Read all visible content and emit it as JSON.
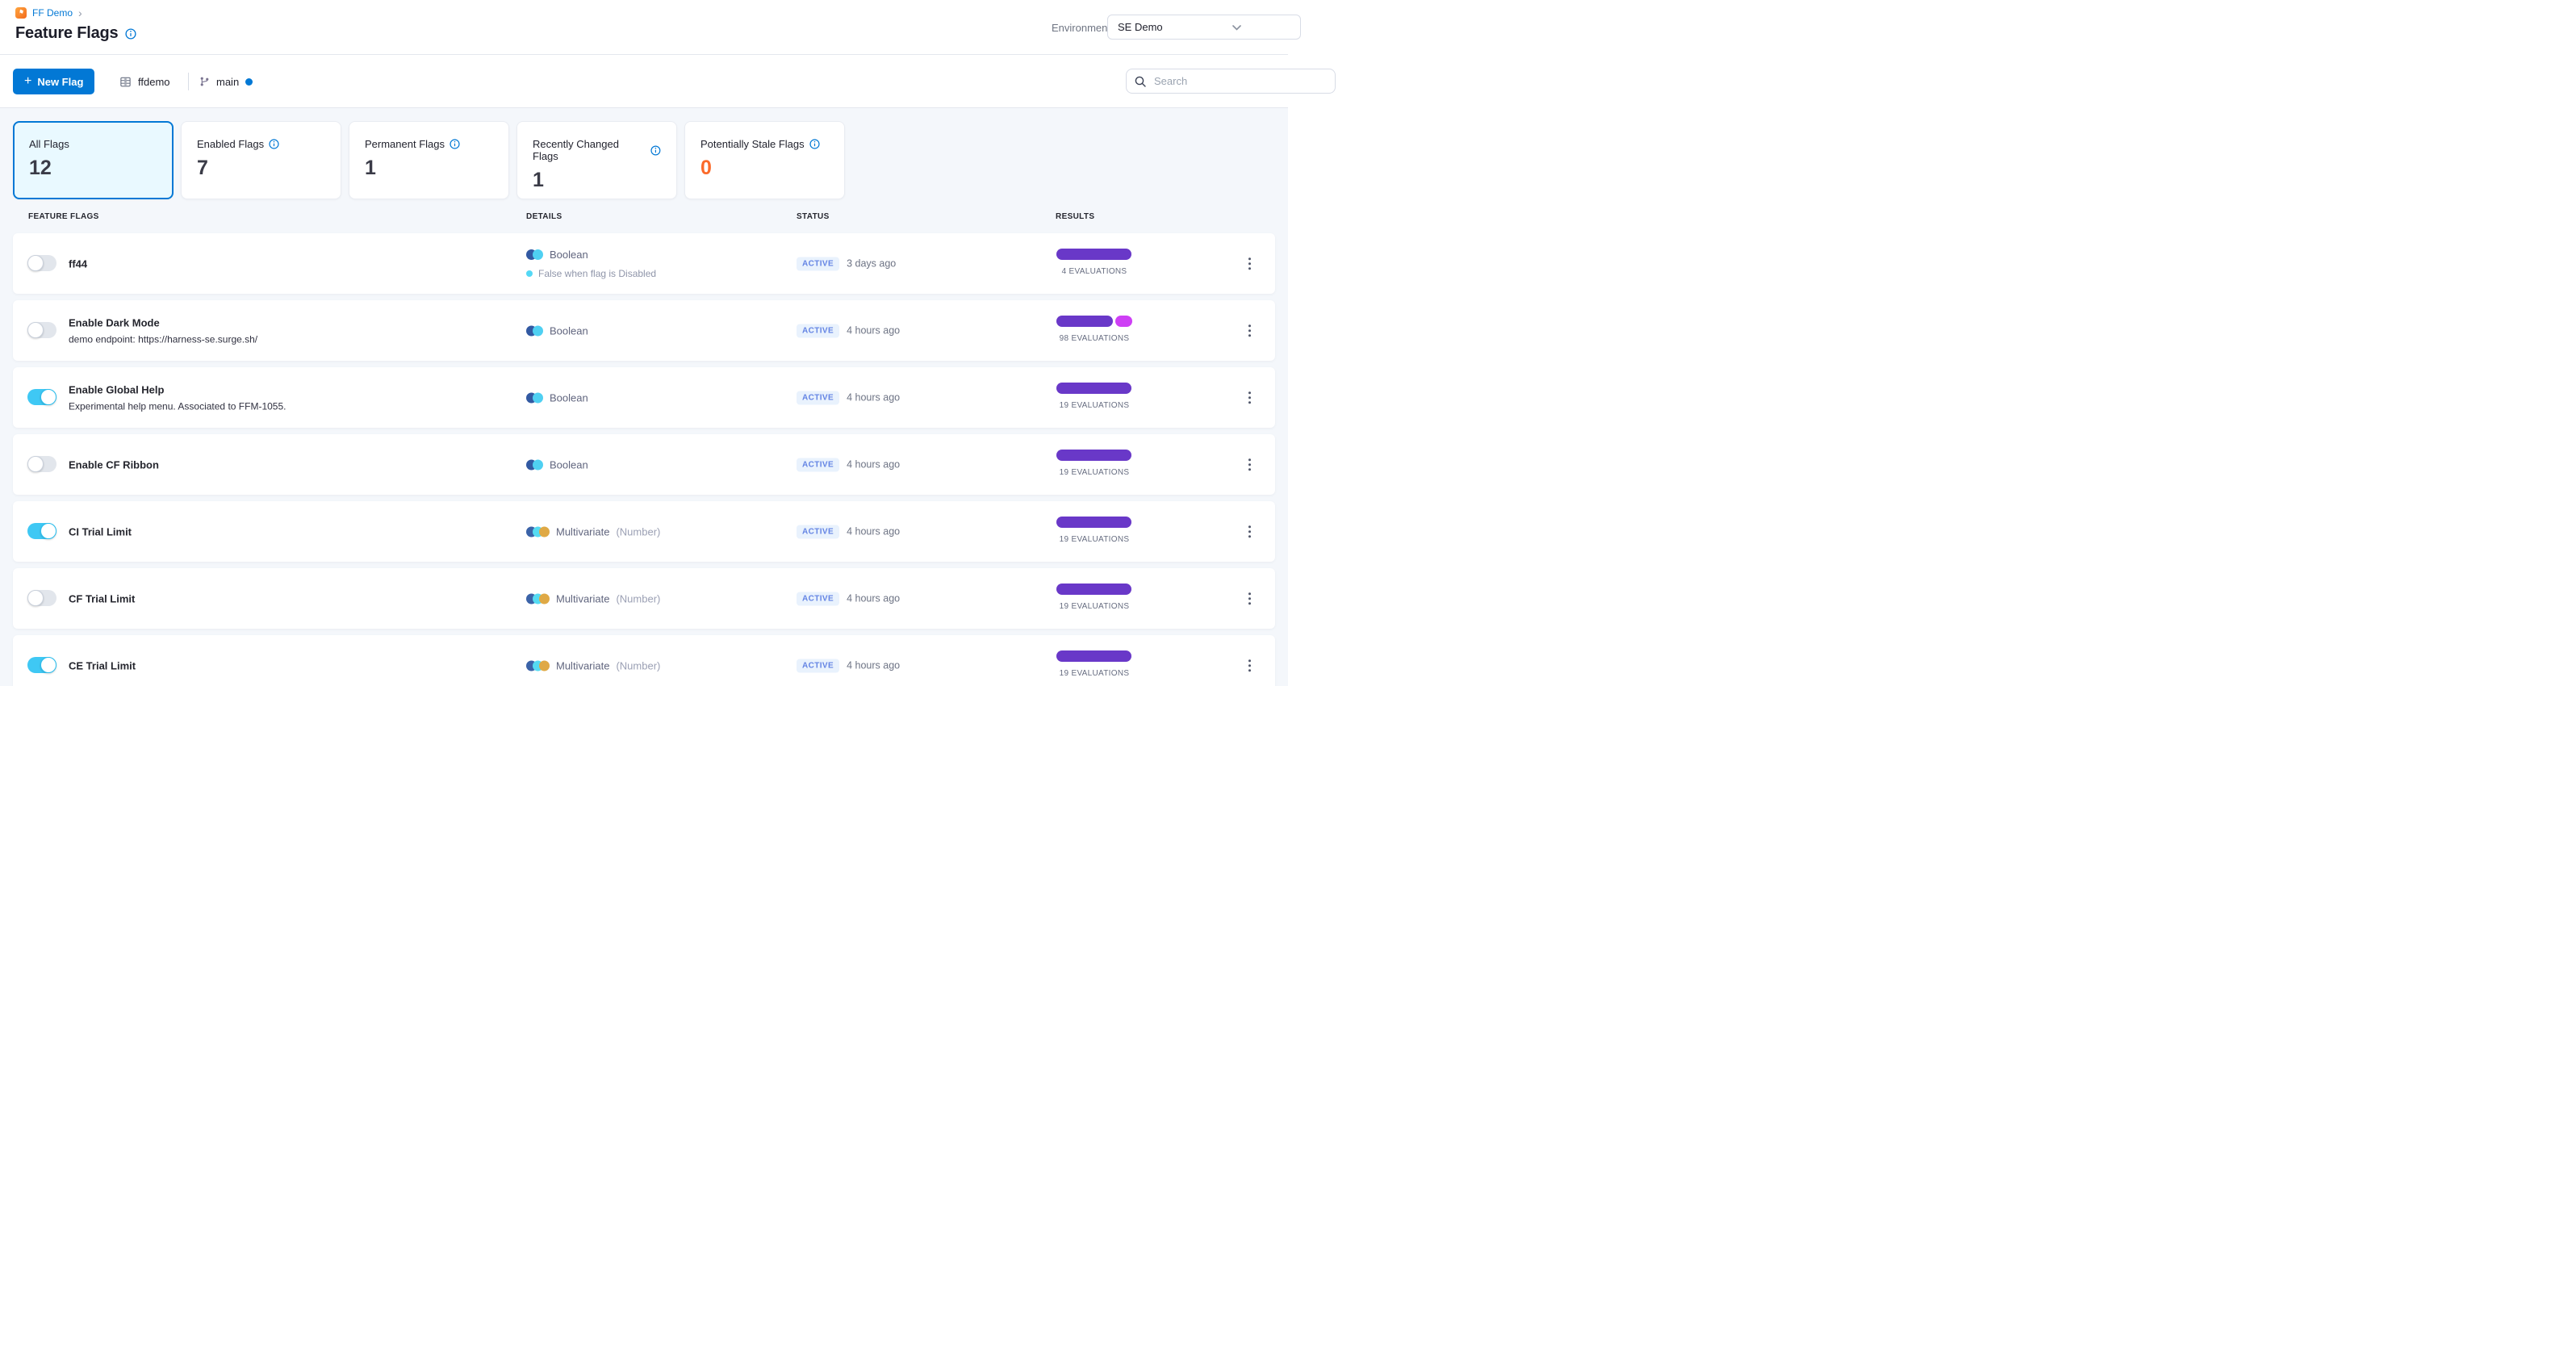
{
  "breadcrumb": {
    "project": "FF Demo",
    "chevron": "›"
  },
  "header": {
    "title": "Feature Flags",
    "environment_label": "Environment",
    "environment_value": "SE Demo"
  },
  "toolbar": {
    "plus": "+",
    "new_flag_label": "New Flag",
    "repo": "ffdemo",
    "branch": "main",
    "search_placeholder": "Search"
  },
  "stats": {
    "cards": [
      {
        "label": "All Flags",
        "value": "12",
        "selected": true,
        "info": false
      },
      {
        "label": "Enabled Flags",
        "value": "7",
        "selected": false,
        "info": true
      },
      {
        "label": "Permanent Flags",
        "value": "1",
        "selected": false,
        "info": true
      },
      {
        "label": "Recently Changed Flags",
        "value": "1",
        "selected": false,
        "info": true
      },
      {
        "label": "Potentially Stale Flags",
        "value": "0",
        "selected": false,
        "info": true,
        "value_color": "#fb6a2a"
      }
    ]
  },
  "colors": {
    "accent_blue": "#0278d5",
    "toggle_on": "#3fc8f4",
    "stale_orange": "#fb6a2a",
    "note_dot": "#54d8f5",
    "type_icons": {
      "Boolean": [
        "#3259a2",
        "#4fd0f2"
      ],
      "Multivariate": [
        "#3b63a8",
        "#55dbf2",
        "#dfa945"
      ]
    }
  },
  "table": {
    "headers": [
      "FEATURE FLAGS",
      "DETAILS",
      "STATUS",
      "RESULTS"
    ],
    "rows": [
      {
        "name": "ff44",
        "description": "",
        "enabled": false,
        "type": "Boolean",
        "type_suffix": "",
        "note": "False when flag is Disabled",
        "status": "ACTIVE",
        "updated": "3 days ago",
        "evaluations": "4 EVALUATIONS",
        "bars": [
          {
            "color": "#6938c8",
            "width": 93
          }
        ]
      },
      {
        "name": "Enable Dark Mode",
        "description": "demo endpoint: https://harness-se.surge.sh/",
        "enabled": false,
        "type": "Boolean",
        "type_suffix": "",
        "note": "",
        "status": "ACTIVE",
        "updated": "4 hours ago",
        "evaluations": "98 EVALUATIONS",
        "bars": [
          {
            "color": "#6938c8",
            "width": 70
          },
          {
            "color": "#ce3ff5",
            "width": 21
          }
        ]
      },
      {
        "name": "Enable Global Help",
        "description": "Experimental help menu. Associated to FFM-1055.",
        "enabled": true,
        "type": "Boolean",
        "type_suffix": "",
        "note": "",
        "status": "ACTIVE",
        "updated": "4 hours ago",
        "evaluations": "19 EVALUATIONS",
        "bars": [
          {
            "color": "#6938c8",
            "width": 93
          }
        ]
      },
      {
        "name": "Enable CF Ribbon",
        "description": "",
        "enabled": false,
        "type": "Boolean",
        "type_suffix": "",
        "note": "",
        "status": "ACTIVE",
        "updated": "4 hours ago",
        "evaluations": "19 EVALUATIONS",
        "bars": [
          {
            "color": "#6938c8",
            "width": 93
          }
        ]
      },
      {
        "name": "CI Trial Limit",
        "description": "",
        "enabled": true,
        "type": "Multivariate",
        "type_suffix": "(Number)",
        "note": "",
        "status": "ACTIVE",
        "updated": "4 hours ago",
        "evaluations": "19 EVALUATIONS",
        "bars": [
          {
            "color": "#6938c8",
            "width": 93
          }
        ]
      },
      {
        "name": "CF Trial Limit",
        "description": "",
        "enabled": false,
        "type": "Multivariate",
        "type_suffix": "(Number)",
        "note": "",
        "status": "ACTIVE",
        "updated": "4 hours ago",
        "evaluations": "19 EVALUATIONS",
        "bars": [
          {
            "color": "#6938c8",
            "width": 93
          }
        ]
      },
      {
        "name": "CE Trial Limit",
        "description": "",
        "enabled": true,
        "type": "Multivariate",
        "type_suffix": "(Number)",
        "note": "",
        "status": "ACTIVE",
        "updated": "4 hours ago",
        "evaluations": "19 EVALUATIONS",
        "bars": [
          {
            "color": "#6938c8",
            "width": 93
          }
        ]
      }
    ]
  }
}
